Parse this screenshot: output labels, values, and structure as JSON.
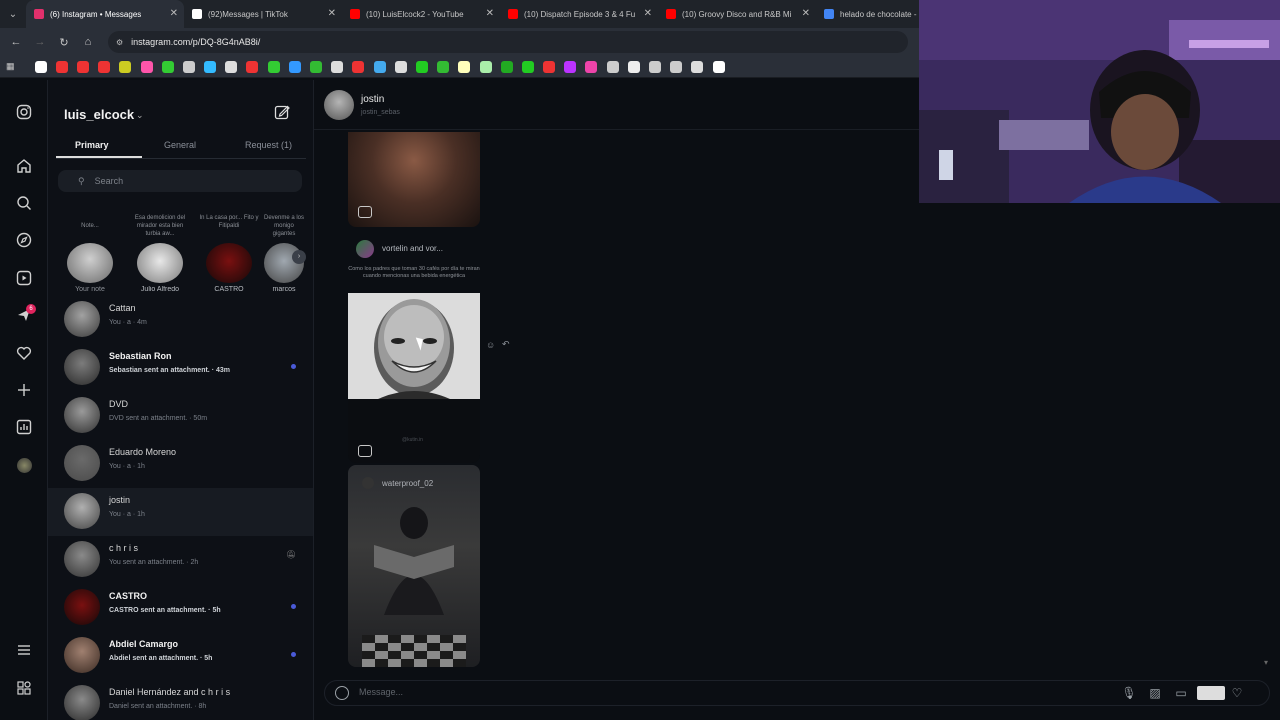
{
  "browser": {
    "tabs": [
      {
        "title": "(6) Instagram • Messages",
        "favicon": "instagram-icon",
        "color": "#e1306c"
      },
      {
        "title": "(92)Messages | TikTok",
        "favicon": "tiktok-icon",
        "color": "#ffffff"
      },
      {
        "title": "(10) LuisElcock2 - YouTube",
        "favicon": "youtube-icon",
        "color": "#ff0000"
      },
      {
        "title": "(10) Dispatch Episode 3 & 4 Fu",
        "favicon": "youtube-icon",
        "color": "#ff0000"
      },
      {
        "title": "(10) Groovy Disco and R&B Mi",
        "favicon": "youtube-icon",
        "color": "#ff0000"
      },
      {
        "title": "helado de chocolate -",
        "favicon": "google-icon",
        "color": "#4285f4"
      }
    ],
    "url": "instagram.com/p/DQ-8G4nAB8i/",
    "bookmark_colors": [
      "#ffffff",
      "#e33",
      "#e33",
      "#e33",
      "#cc2",
      "#f5a",
      "#3c3",
      "#ccc",
      "#3bf",
      "#ddd",
      "#e33",
      "#3c3",
      "#39f",
      "#3b3",
      "#ddd",
      "#e33",
      "#4ae",
      "#ddd",
      "#2c2",
      "#3b3",
      "#ffb",
      "#aea",
      "#2a2",
      "#2c2",
      "#e33",
      "#b3f",
      "#e4a",
      "#ccc",
      "#eee",
      "#ccc",
      "#ccc",
      "#ddd",
      "#fff"
    ]
  },
  "rail": {
    "icons": [
      "instagram-logo-icon",
      "home-icon",
      "search-icon",
      "explore-icon",
      "reels-icon",
      "messages-icon",
      "notifications-icon",
      "create-icon",
      "dashboard-icon",
      "profile-icon",
      "menu-icon",
      "threads-icon"
    ],
    "badge": "6"
  },
  "inbox": {
    "account": "luis_elcock",
    "tabs": {
      "primary": "Primary",
      "general": "General",
      "requests": "Request (1)"
    },
    "search_placeholder": "Search",
    "notes": [
      {
        "bubble": "Note...",
        "name": "Your note"
      },
      {
        "bubble": "Esa demolicion del mirador esta bien turbia aw...",
        "name": "Julio Alfredo"
      },
      {
        "bubble": "In La casa por... Fito y Fitipaldi",
        "name": "CASTRO"
      },
      {
        "bubble": "Devenme a los monigo gigantes",
        "name": "marcos"
      }
    ],
    "conversations": [
      {
        "name": "Cattan",
        "preview": "You · a · 4m",
        "bold": false,
        "dot": false
      },
      {
        "name": "Sebastian Ron",
        "preview": "Sebastian sent an attachment. · 43m",
        "bold": true,
        "dot": true
      },
      {
        "name": "DVD",
        "preview": "DVD sent an attachment. · 50m",
        "bold": false,
        "dot": false
      },
      {
        "name": "Eduardo Moreno",
        "preview": "You · a · 1h",
        "bold": false,
        "dot": false
      },
      {
        "name": "jostin",
        "preview": "You · a · 1h",
        "bold": false,
        "dot": false,
        "selected": true
      },
      {
        "name": "c h r i s",
        "preview": "You sent an attachment. · 2h",
        "bold": false,
        "dot": false,
        "muted": true
      },
      {
        "name": "CASTRO",
        "preview": "CASTRO sent an attachment. · 5h",
        "bold": true,
        "dot": true
      },
      {
        "name": "Abdiel Camargo",
        "preview": "Abdiel sent an attachment. · 5h",
        "bold": true,
        "dot": true
      },
      {
        "name": "Daniel Hernández and c h r i s",
        "preview": "Daniel sent an attachment. · 8h",
        "bold": false,
        "dot": false
      }
    ]
  },
  "chat": {
    "name": "jostin",
    "username": "jostin_sebas",
    "shared_post": {
      "author": "vortelin and vor...",
      "caption": "Como los padres que toman 30 cafés por día te miran cuando mencionas una bebida energética",
      "watermark": "@kutin.in"
    },
    "reel_author": "waterproof_02",
    "message_placeholder": "Message..."
  }
}
